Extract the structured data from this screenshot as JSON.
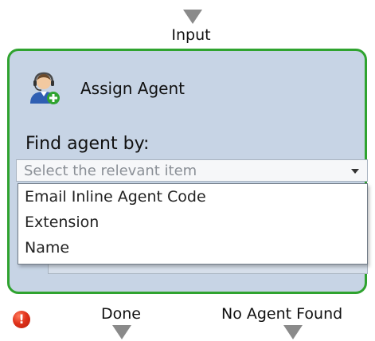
{
  "ports": {
    "input": "Input",
    "outputs": {
      "done": "Done",
      "no_agent_found": "No Agent Found"
    }
  },
  "activity": {
    "title": "Assign Agent",
    "icon": "assign-agent-icon",
    "find_by_label": "Find agent by:",
    "select": {
      "placeholder": "Select the relevant item",
      "options": [
        "Email Inline Agent Code",
        "Extension",
        "Name"
      ]
    },
    "status_icon": "error-icon",
    "status_glyph": "!"
  },
  "colors": {
    "border_accent": "#2fa32f",
    "box_fill": "#c7d4e5",
    "port_arrow": "#8a8a8a",
    "error": "#e0321b"
  }
}
